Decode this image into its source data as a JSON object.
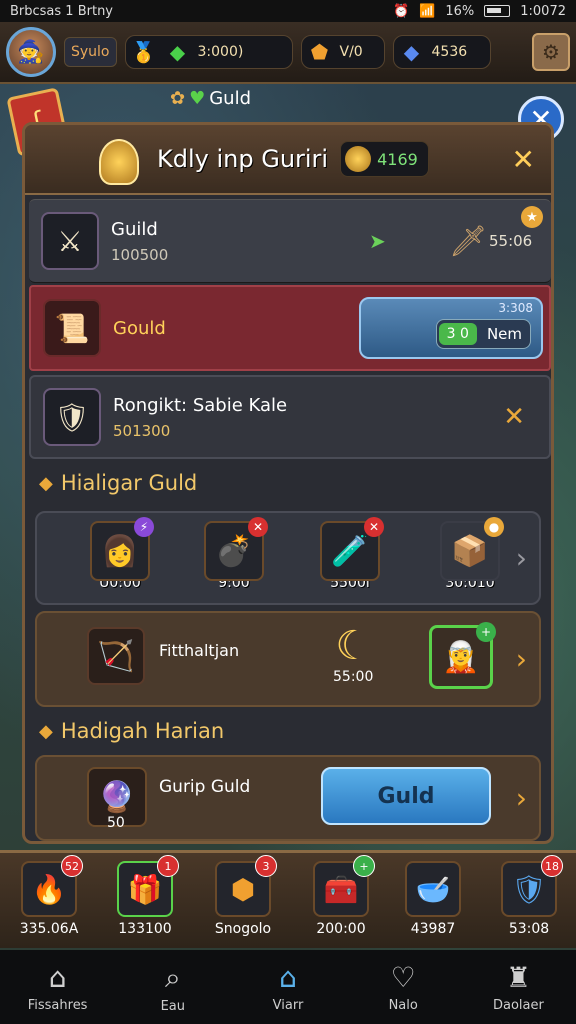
{
  "status": {
    "left": "Brbcsas 1 Brtny",
    "battery_pct": "16%",
    "time": "1:0072"
  },
  "top": {
    "guild_tag": "Syulo",
    "resources": [
      {
        "icon": "gold-bar-icon",
        "value": ""
      },
      {
        "icon": "green-gem-icon",
        "value": "3:000)"
      },
      {
        "icon": "orange-gem-icon",
        "value": "V/0"
      },
      {
        "icon": "blue-gem-icon",
        "value": "4536"
      }
    ]
  },
  "above_panel_label": "Guld",
  "panel": {
    "title": "Kdly inp Guriri",
    "gold": "4169",
    "rows": [
      {
        "name": "Guild",
        "sub": "100500",
        "percent": "55:06"
      },
      {
        "name": "Gould",
        "btn_small": "3:308",
        "btn_chip": "3 0",
        "btn_label": "Nem"
      },
      {
        "name": "Rongikt: Sabie Kale",
        "sub": "501300"
      }
    ],
    "section1": "Hialigar Guld",
    "cards1": [
      {
        "value": "U0:00",
        "icon": "purple-hero-icon"
      },
      {
        "value": "9:00",
        "icon": "cannon-icon"
      },
      {
        "value": "5500i",
        "icon": "green-scroll-icon"
      },
      {
        "value": "30:010",
        "icon": "crate-icon"
      }
    ],
    "card2": {
      "label": "Fitthaltjan",
      "moon_value": "55:00"
    },
    "section2": "Hadigah Harian",
    "card3": {
      "label": "Gurip Guld",
      "num": "50",
      "button": "Guld"
    }
  },
  "inventory": [
    {
      "value": "335.06A",
      "badge": "52"
    },
    {
      "value": "133100",
      "badge": "1"
    },
    {
      "value": "Snogolo",
      "badge": "3"
    },
    {
      "value": "200:00",
      "badge": "+"
    },
    {
      "value": "43987",
      "badge": ""
    },
    {
      "value": "53:08",
      "badge": "18"
    }
  ],
  "nav": [
    {
      "label": "Fissahres",
      "icon": "home-icon"
    },
    {
      "label": "Eau",
      "icon": "search-icon"
    },
    {
      "label": "Viarr",
      "icon": "house-outline-icon"
    },
    {
      "label": "Nalo",
      "icon": "heart-icon"
    },
    {
      "label": "Daolaer",
      "icon": "trophy-icon"
    }
  ],
  "colors": {
    "accent_gold": "#e9a83a",
    "panel_red": "#7a2830",
    "button_blue": "#2a78c0"
  }
}
